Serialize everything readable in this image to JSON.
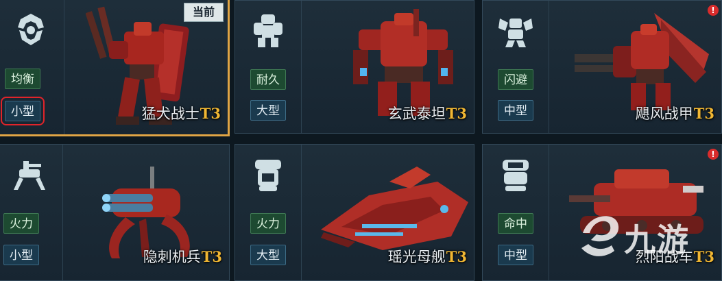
{
  "cards": [
    {
      "name": "猛犬战士",
      "tier": "T3",
      "role": "均衡",
      "size": "小型",
      "icon": "balanced-class-icon",
      "badge": "当前"
    },
    {
      "name": "玄武泰坦",
      "tier": "T3",
      "role": "耐久",
      "size": "大型",
      "icon": "durable-class-icon"
    },
    {
      "name": "飓风战甲",
      "tier": "T3",
      "role": "闪避",
      "size": "中型",
      "icon": "evasion-class-icon",
      "alert": "!"
    },
    {
      "name": "隐刺机兵",
      "tier": "T3",
      "role": "火力",
      "size": "小型",
      "icon": "firepower-class-icon"
    },
    {
      "name": "瑶光母舰",
      "tier": "T3",
      "role": "火力",
      "size": "大型",
      "icon": "firepower-class-icon"
    },
    {
      "name": "烈阳战车",
      "tier": "T3",
      "role": "命中",
      "size": "中型",
      "icon": "accuracy-class-icon",
      "alert": "!"
    }
  ],
  "watermark": {
    "text": "九游"
  },
  "colors": {
    "selected_border": "#e0a545",
    "tier": "#f1b733",
    "role_tag": "#1d4a31",
    "size_tag": "#1a3a4e",
    "alert": "#d92c2c"
  }
}
